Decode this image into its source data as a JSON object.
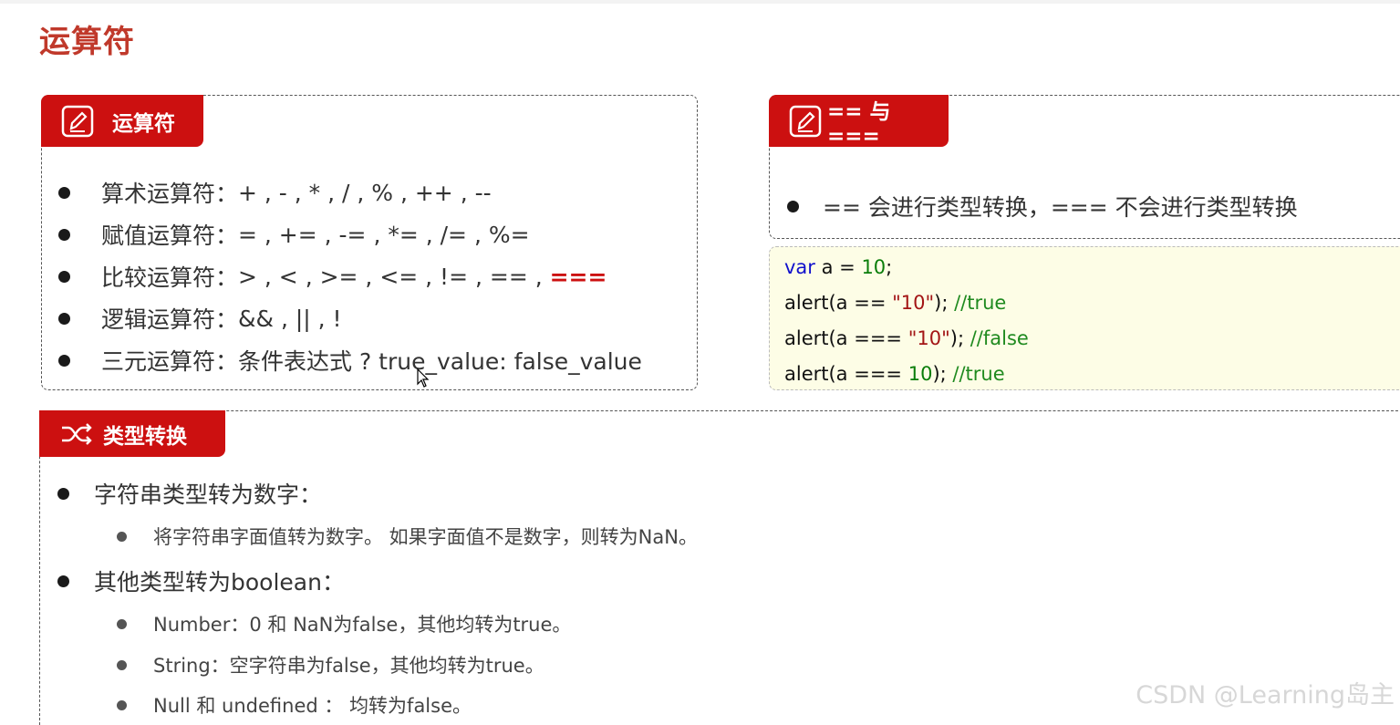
{
  "page": {
    "title": "运算符"
  },
  "operators": {
    "tag_label": "运算符",
    "items": [
      {
        "label": "算术运算符：",
        "value": "+ , - , * , / , % , ++ , --"
      },
      {
        "label": "赋值运算符：",
        "value": "= , += , -= , *= , /= , %="
      },
      {
        "label": "比较运算符：",
        "value": "> , < , >= , <= , != , == , ",
        "highlight": "==="
      },
      {
        "label": "逻辑运算符：",
        "value": "&& , || , !"
      },
      {
        "label": "三元运算符：",
        "value": "条件表达式 ? true_value: false_value"
      }
    ]
  },
  "equality": {
    "tag_label": "== 与 ===",
    "text": "== 会进行类型转换，=== 不会进行类型转换",
    "code": {
      "line1": {
        "kw": "var",
        "mid": " a = ",
        "num": "10",
        "end": ";"
      },
      "line2": {
        "pre": "alert(a == ",
        "str": "\"10\"",
        "mid": "); ",
        "cm": "//true"
      },
      "line3": {
        "pre": "alert(a === ",
        "str": "\"10\"",
        "mid": "); ",
        "cm": "//false"
      },
      "line4": {
        "pre": "alert(a === ",
        "num": "10",
        "mid": "); ",
        "cm": "//true"
      }
    }
  },
  "conversion": {
    "tag_label": "类型转换",
    "string_to_number": "字符串类型转为数字：",
    "string_to_number_detail": "将字符串字面值转为数字。 如果字面值不是数字，则转为NaN。",
    "to_boolean": "其他类型转为boolean：",
    "boolean_details": [
      "Number：0 和 NaN为false，其他均转为true。",
      "String：空字符串为false，其他均转为true。",
      "Null 和 undefined ： 均转为false。"
    ]
  },
  "watermark": "CSDN @Learning岛主",
  "colors": {
    "accent": "#cc1010",
    "title": "#c0392b",
    "code_bg": "#fdfde6"
  },
  "icons": {
    "operators": "pencil-edit-icon",
    "equality": "pencil-edit-icon",
    "conversion": "shuffle-icon"
  }
}
